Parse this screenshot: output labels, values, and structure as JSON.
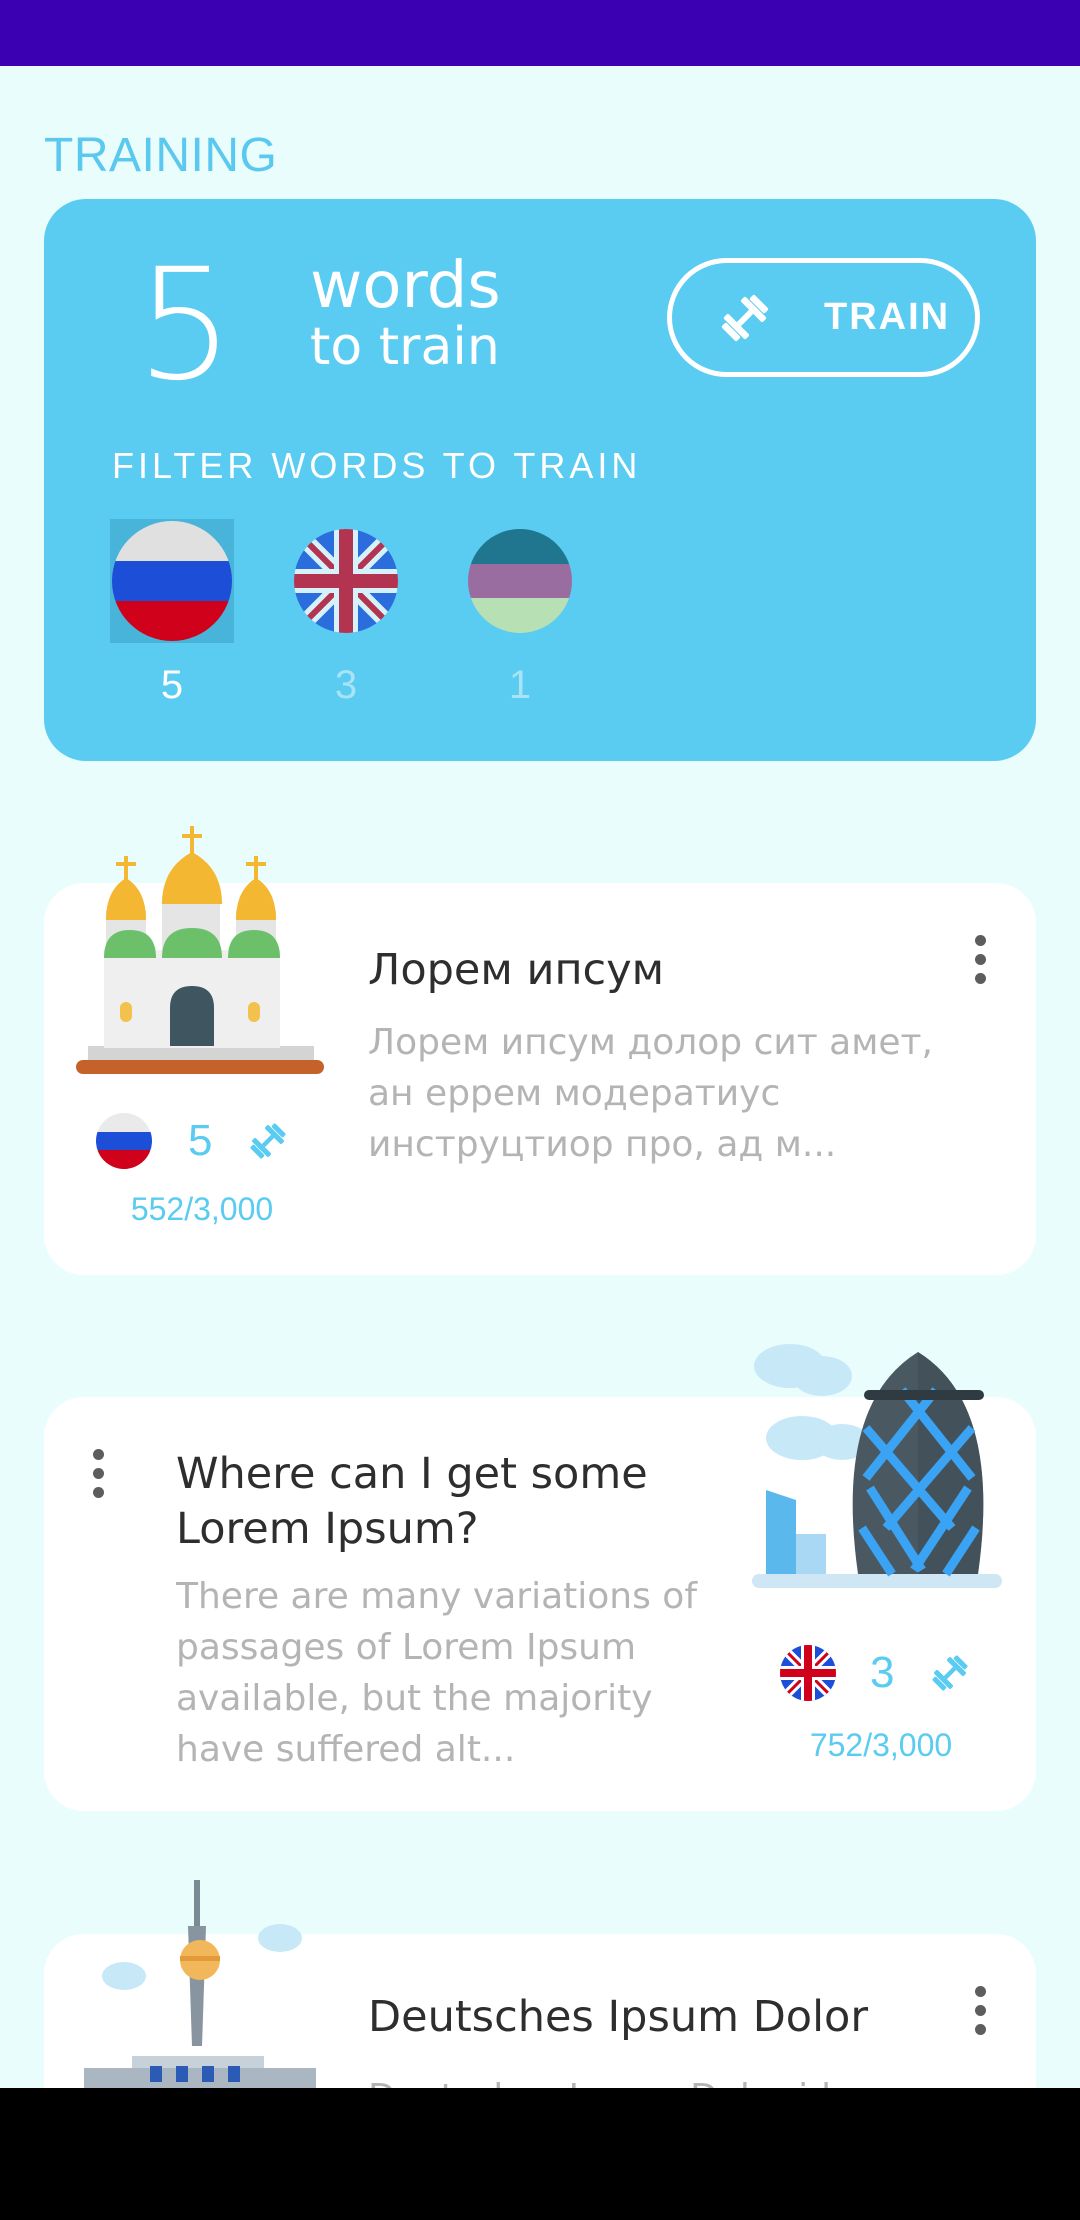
{
  "training": {
    "section_title": "TRAINING",
    "count": "5",
    "words_label": "words",
    "sub_label": "to train",
    "train_button": "TRAIN",
    "filter_label": "FILTER WORDS TO TRAIN",
    "filters": [
      {
        "language": "Russian",
        "flag": "russian-flag-icon",
        "count": "5",
        "selected": true
      },
      {
        "language": "English",
        "flag": "uk-flag-icon",
        "count": "3",
        "selected": false
      },
      {
        "language": "Other",
        "flag": "tricolor-flag-icon",
        "count": "1",
        "selected": false
      }
    ]
  },
  "lessons": [
    {
      "title": "Лорем ипсум",
      "description": "Лорем ипсум долор сит амет, ан еррем модератиус инструцтиор про, ад м...",
      "count": "5",
      "progress": "552/3,000",
      "illustration": "cathedral-illustration",
      "flag": "russian-flag-icon"
    },
    {
      "title": "Where can I get some Lorem Ipsum?",
      "description": "There are many variations of passages of Lorem Ipsum available, but the majority have suffered alt...",
      "count": "3",
      "progress": "752/3,000",
      "illustration": "gherkin-tower-illustration",
      "flag": "uk-flag-icon"
    },
    {
      "title": "Deutsches Ipsum Dolor",
      "description": "Deutsches Ipsum Dolor id",
      "illustration": "tv-tower-illustration"
    }
  ],
  "colors": {
    "accent": "#5acbf1",
    "status_bar": "#3a00b2",
    "background": "#eafdfd"
  }
}
